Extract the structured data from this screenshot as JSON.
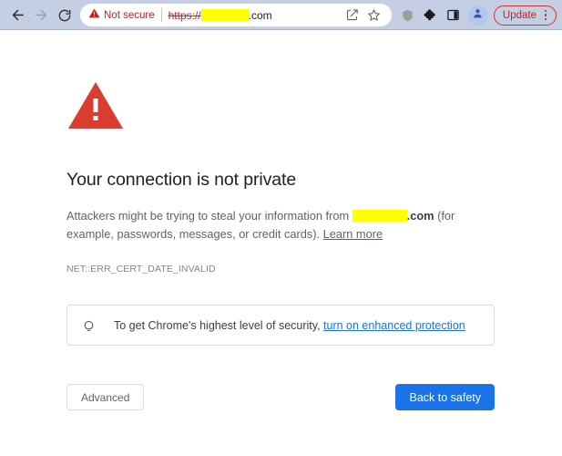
{
  "browser": {
    "nav": {
      "back_icon": "arrow-left-icon",
      "forward_icon": "arrow-right-icon",
      "reload_icon": "reload-icon"
    },
    "omnibox": {
      "security_icon": "warning-triangle-icon",
      "security_label": "Not secure",
      "url_scheme": "https://",
      "url_redacted": "",
      "url_tld": ".com",
      "actions": [
        "share-icon",
        "bookmark-star-icon"
      ]
    },
    "toolbar": {
      "shield_icon": "shield-icon",
      "extensions_icon": "puzzle-piece-icon",
      "side_panel_icon": "side-panel-icon",
      "avatar_icon": "profile-avatar-icon",
      "update_label": "Update",
      "update_menu_icon": "three-dot-menu-icon"
    }
  },
  "interstitial": {
    "icon": "red-warning-triangle-icon",
    "title": "Your connection is not private",
    "paragraph": {
      "before_host": "Attackers might be trying to steal your information from ",
      "host_redacted": "",
      "host_tld": ".com",
      "after_host": " (for example, passwords, messages, or credit cards). ",
      "learn_more": "Learn more"
    },
    "error_code": "NET::ERR_CERT_DATE_INVALID",
    "enhanced_protection": {
      "icon": "lightbulb-icon",
      "text": "To get Chrome's highest level of security, ",
      "link": "turn on enhanced protection"
    },
    "buttons": {
      "advanced": "Advanced",
      "back_to_safety": "Back to safety"
    }
  },
  "colors": {
    "chrome_toolbar": "#c5cfe3",
    "danger_red": "#c5221f",
    "warning_triangle": "#db3c30",
    "link_blue": "#1a73e8",
    "button_blue": "#1a73e8",
    "redaction_yellow": "#ffff00",
    "body_text": "#5f6368"
  }
}
